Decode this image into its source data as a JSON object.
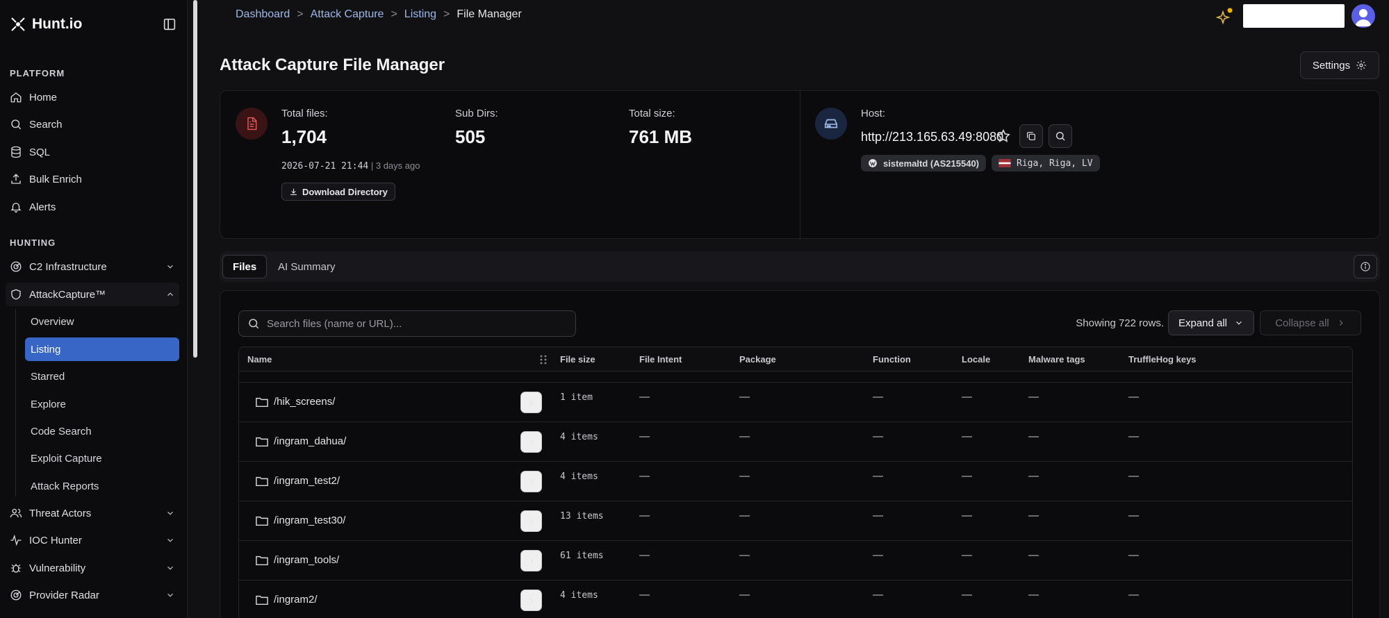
{
  "brand": {
    "name": "Hunt.io"
  },
  "sidebar": {
    "platform_label": "PLATFORM",
    "hunting_label": "HUNTING",
    "platform_items": [
      {
        "label": "Home",
        "icon": "home-icon"
      },
      {
        "label": "Search",
        "icon": "search-icon"
      },
      {
        "label": "SQL",
        "icon": "database-icon"
      },
      {
        "label": "Bulk Enrich",
        "icon": "upload-icon"
      },
      {
        "label": "Alerts",
        "icon": "bell-icon"
      }
    ],
    "hunting_items": [
      {
        "label": "C2 Infrastructure",
        "icon": "radar-icon"
      },
      {
        "label": "AttackCapture™",
        "icon": "shield-icon"
      }
    ],
    "attackcapture_sub": [
      "Overview",
      "Listing",
      "Starred",
      "Explore",
      "Code Search",
      "Exploit Capture",
      "Attack Reports"
    ],
    "more_items": [
      {
        "label": "Threat Actors",
        "icon": "users-icon"
      },
      {
        "label": "IOC Hunter",
        "icon": "activity-icon"
      },
      {
        "label": "Vulnerability",
        "icon": "bug-icon"
      },
      {
        "label": "Provider Radar",
        "icon": "radar-icon"
      }
    ]
  },
  "breadcrumb": [
    "Dashboard",
    "Attack Capture",
    "Listing",
    "File Manager"
  ],
  "page": {
    "title": "Attack Capture File Manager",
    "settings_label": "Settings"
  },
  "summary": {
    "total_files_label": "Total files:",
    "total_files": "1,704",
    "sub_dirs_label": "Sub Dirs:",
    "sub_dirs": "505",
    "total_size_label": "Total size:",
    "total_size": "761 MB",
    "timestamp": "2026-07-21 21:44",
    "ago": "| 3 days ago",
    "download_label": "Download Directory",
    "host_label": "Host:",
    "host": "http://213.165.63.49:8080",
    "asn_tag": "sistemaltd (AS215540)",
    "location_tag": "Riga, Riga, LV"
  },
  "tabs": [
    "Files",
    "AI Summary"
  ],
  "files": {
    "search_placeholder": "Search files (name or URL)...",
    "rows_info": "Showing 722 rows.",
    "expand_all": "Expand all",
    "collapse_all": "Collapse all",
    "columns": [
      "Name",
      "File size",
      "File Intent",
      "Package",
      "Function",
      "Locale",
      "Malware tags",
      "TruffleHog keys"
    ],
    "rows": [
      {
        "name": "/hik_screens/",
        "size": "1 item"
      },
      {
        "name": "/ingram_dahua/",
        "size": "4 items"
      },
      {
        "name": "/ingram_test2/",
        "size": "4 items"
      },
      {
        "name": "/ingram_test30/",
        "size": "13 items"
      },
      {
        "name": "/ingram_tools/",
        "size": "61 items"
      },
      {
        "name": "/ingram2/",
        "size": "4 items"
      }
    ],
    "empty_value": "—"
  },
  "colors": {
    "accent": "#3766c6",
    "avatar": "#5b5fe6",
    "file_icon_bg": "#3a1414",
    "host_icon_bg": "#1a2540"
  }
}
